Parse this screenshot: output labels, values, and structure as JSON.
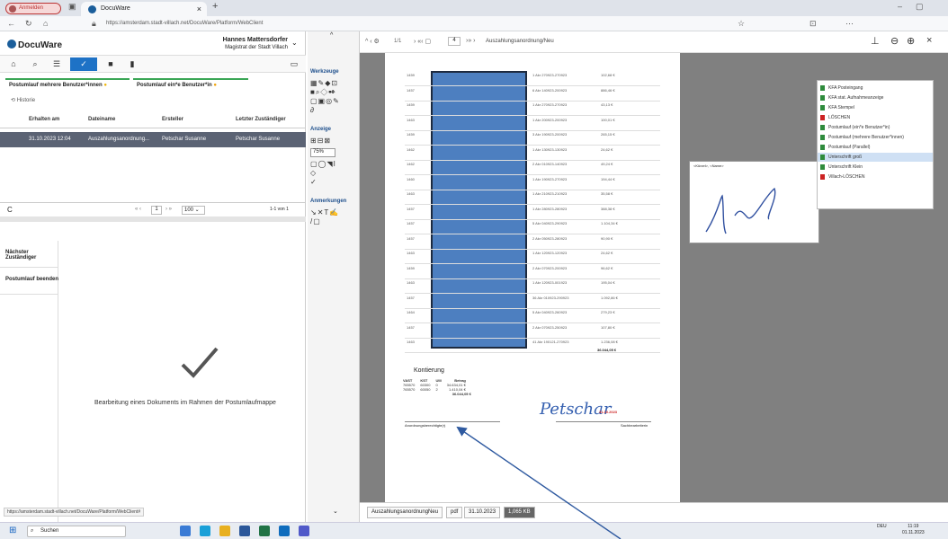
{
  "browser": {
    "account_label": "Anmelden",
    "tab_title": "DocuWare",
    "tab_close": "×",
    "new_tab": "+",
    "url": "https://amsterdam.stadt-villach.net/DocuWare/Platform/WebClient"
  },
  "app": {
    "logo": "DocuWare",
    "user_name": "Hannes Mattersdorfer",
    "user_org": "Magistrat der Stadt Villach"
  },
  "tabs": [
    {
      "label": "Postumlauf mehrere Benutzer*innen"
    },
    {
      "label": "Postumlauf ein*e Benutzer*in"
    }
  ],
  "history": "Historie",
  "columns": [
    "Erhalten am",
    "Dateiname",
    "Ersteller",
    "Letzter Zuständiger"
  ],
  "rows": [
    {
      "received": "31.10.2023 12:04",
      "filename": "Auszahlungsanordnung...",
      "creator": "Petschar Susanne",
      "last": "Petschar Susanne"
    }
  ],
  "pager": {
    "page": "1",
    "size": "100",
    "range": "1-1 von 1"
  },
  "actions": [
    "Nächster Zuständiger",
    "Postumlauf beenden"
  ],
  "done_message": "Bearbeitung eines Dokuments im Rahmen der Postumlaufmappe",
  "panel": {
    "tools": "Werkzeuge",
    "view": "Anzeige",
    "zoom": "75%",
    "annotations": "Anmerkungen"
  },
  "viewer": {
    "page": "1/1",
    "page_num": "4",
    "doc_title": "Auszahlungsanordnung/Neu"
  },
  "document": {
    "rows": [
      {
        "a": "1459",
        "b": "1 Akr 270923-270923",
        "c": "102,68 €"
      },
      {
        "a": "1457",
        "b": "6 Akr 140923-200923",
        "c": "886,46 €"
      },
      {
        "a": "1459",
        "b": "1 Akr 270923-270923",
        "c": "43,13 €"
      },
      {
        "a": "1463",
        "b": "1 Akr 200923-200923",
        "c": "100,01 €"
      },
      {
        "a": "1459",
        "b": "3 Akr 190923-200923",
        "c": "265,15 €"
      },
      {
        "a": "1462",
        "b": "1 Akr 130923-130923",
        "c": "24,62 €"
      },
      {
        "a": "1462",
        "b": "2 Akr 010923-140923",
        "c": "49,24 €"
      },
      {
        "a": "1460",
        "b": "1 Akr 190923-270923",
        "c": "194,44 €"
      },
      {
        "a": "1463",
        "b": "1 Akr 210923-210923",
        "c": "35,58 €"
      },
      {
        "a": "1457",
        "b": "1 Akr 280923-280923",
        "c": "388,38 €"
      },
      {
        "a": "1457",
        "b": "5 Akr 040923-290923",
        "c": "1.104,34 €"
      },
      {
        "a": "1457",
        "b": "2 Akr 050923-280923",
        "c": "90,90 €"
      },
      {
        "a": "1463",
        "b": "1 Akr 120923-120923",
        "c": "24,62 €"
      },
      {
        "a": "1459",
        "b": "2 Akr 070923-200923",
        "c": "96,62 €"
      },
      {
        "a": "1463",
        "b": "1 Akr 120923-001923",
        "c": "195,04 €"
      },
      {
        "a": "1457",
        "b": "36 Akr 010923-290923",
        "c": "1.092,86 €"
      },
      {
        "a": "1464",
        "b": "5 Akr 040923-260923",
        "c": "279,23 €"
      },
      {
        "a": "1457",
        "b": "2 Akr 070923-250923",
        "c": "107,80 €"
      },
      {
        "a": "1463",
        "b": "41 Akr 190121-270923",
        "c": "1.236,08 €"
      }
    ],
    "total": "36.044,05 €",
    "konti_title": "Kontierung",
    "konti_headers": [
      "VAST",
      "KST",
      "UIII",
      "Betrag"
    ],
    "konti_rows": [
      [
        "765570",
        "60300",
        "0",
        "34.634,01 €"
      ],
      [
        "765570",
        "60050",
        "2",
        "1.410,04 €"
      ]
    ],
    "konti_total": "36.044,05 €",
    "signature": "Petschar",
    "sign_date": "31.10.2023",
    "label_left": "Anordnungsberechtigte(r)",
    "label_right": "Sachbearbeiterin",
    "sig_header": "<Kürzel>, <Name>"
  },
  "stamps": [
    {
      "label": "KFA Posteingang",
      "color": "green"
    },
    {
      "label": "KFA stat. Aufnahmeanzeige",
      "color": "green"
    },
    {
      "label": "KFA Stempel",
      "color": "green"
    },
    {
      "label": "LÖSCHEN",
      "color": "red"
    },
    {
      "label": "Postumlauf (ein*e Benutzer*in)",
      "color": "green"
    },
    {
      "label": "Postumlauf (mehrere Benutzer*innen)",
      "color": "green"
    },
    {
      "label": "Postumlauf (Parallel)",
      "color": "green"
    },
    {
      "label": "Unterschrift groß",
      "color": "blue"
    },
    {
      "label": "Unterschrift Klein",
      "color": "green"
    },
    {
      "label": "Villach-LÖSCHEN",
      "color": "red"
    }
  ],
  "status": {
    "filename": "AuszahlungsanordnungNeu",
    "type": "pdf",
    "date": "31.10.2023",
    "size": "1,065 KB"
  },
  "status_url": "https://amsterdam.stadt-villach.net/DocuWare/Platform/WebClient#",
  "taskbar": {
    "search": "Suchen",
    "time": "11:19",
    "date": "01.11.2023",
    "lang": "DEU"
  }
}
